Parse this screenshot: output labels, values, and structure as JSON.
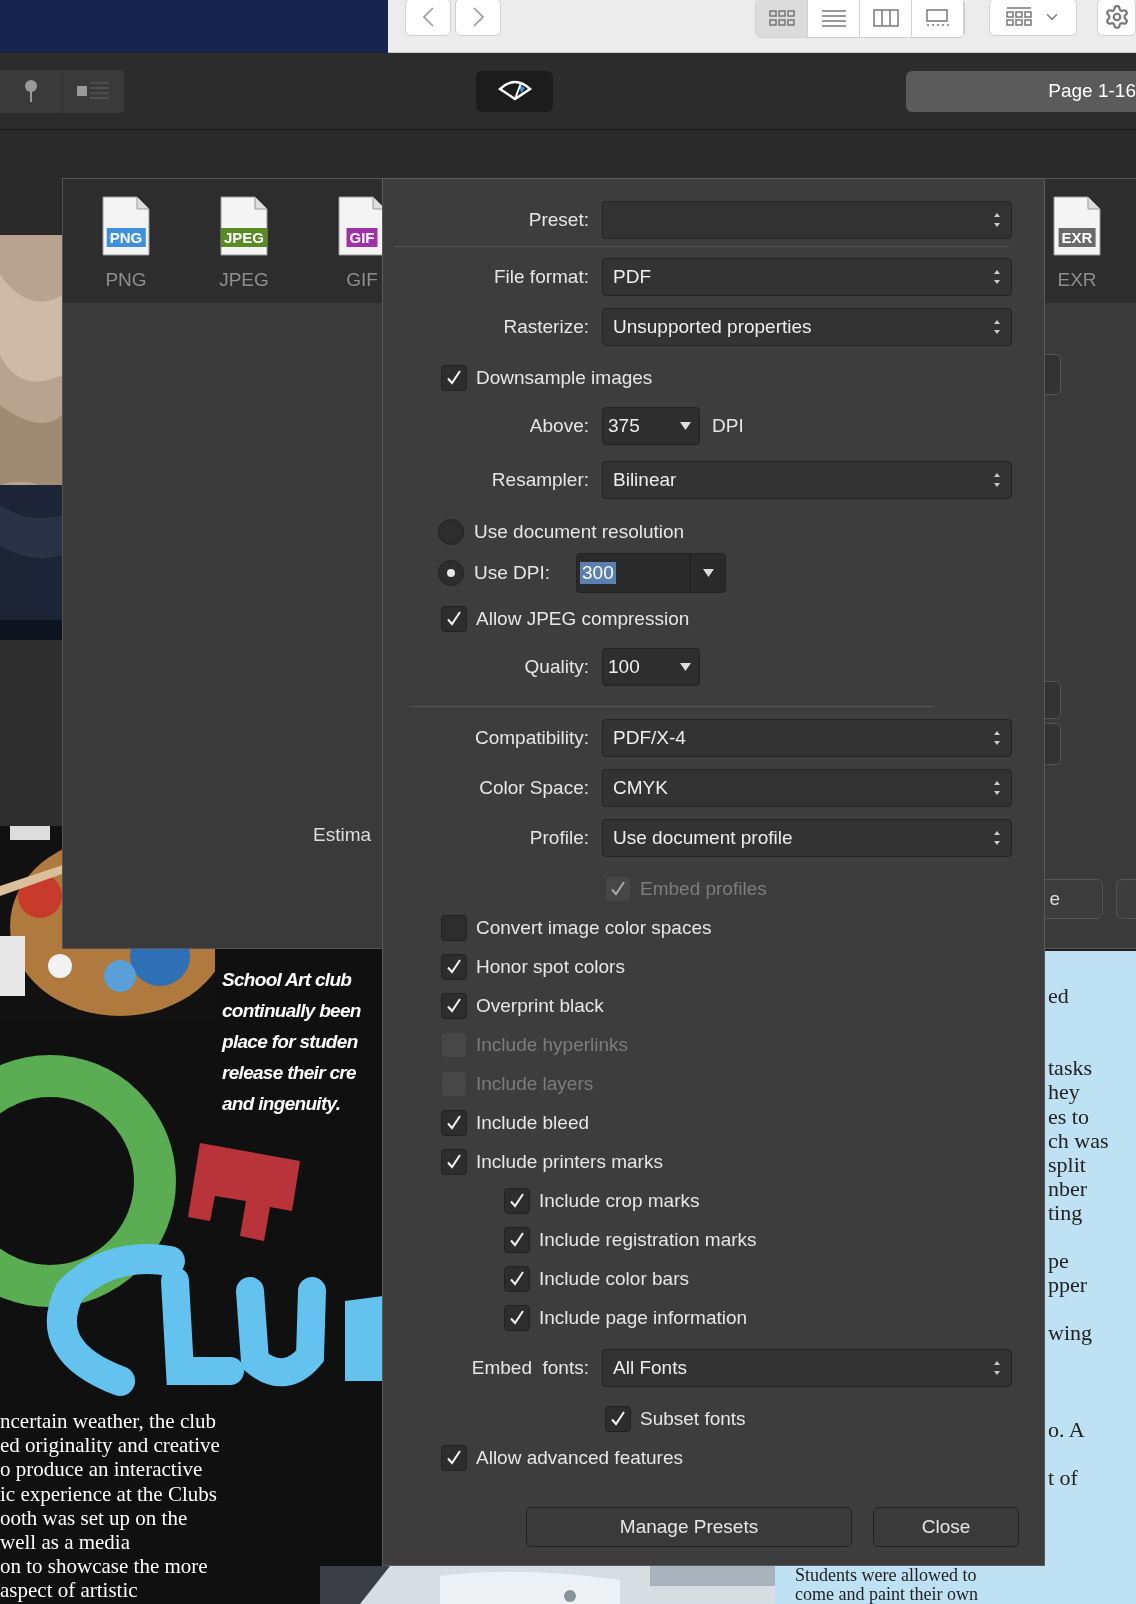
{
  "finder_toolbar": {
    "view_modes": [
      {
        "selected": true
      },
      {
        "selected": false
      },
      {
        "selected": false
      },
      {
        "selected": false
      }
    ]
  },
  "app_toolbar": {
    "page_field": "Page 1-16"
  },
  "export_window": {
    "formats": [
      {
        "badge": "PNG",
        "label": "PNG",
        "color": "#3d8fe0"
      },
      {
        "badge": "JPEG",
        "label": "JPEG",
        "color": "#5a8a24"
      },
      {
        "badge": "GIF",
        "label": "GIF",
        "color": "#a030a8"
      },
      {
        "badge": "EXR",
        "label": "EXR",
        "color": "#6a6a6a"
      }
    ],
    "estimate_label": "Estima",
    "action_button": "e"
  },
  "document": {
    "poster_lines": [
      "School Art club",
      "continually been",
      "place for studen",
      "release their cre",
      "and ingenuity."
    ],
    "poster_paragraph": [
      "ncertain weather, the club",
      "ed originality and creative",
      "o produce an interactive",
      "ic experience at the Clubs",
      "ooth was set up on the",
      "well as a media",
      "on to showcase the more",
      "aspect of artistic"
    ],
    "page_lines": [
      "ed",
      "tasks",
      "hey",
      "es to",
      "ch was",
      "split",
      "nber",
      "ting",
      "pe",
      "pper",
      "wing",
      "o. A",
      "t of"
    ],
    "page_bottom_lines": [
      "Students were allowed to",
      "come and paint their own"
    ]
  },
  "dialog": {
    "sections": [
      {
        "rows": [
          {
            "kind": "select",
            "label": "Preset:"
          }
        ]
      },
      {
        "rows": [
          {
            "kind": "select",
            "label": "File format:",
            "value": "PDF"
          },
          {
            "kind": "select",
            "label": "Rasterize:",
            "value": "Unsupported properties"
          },
          {
            "kind": "checkbox",
            "label": "Downsample images",
            "checked": true,
            "disabled": false
          },
          {
            "kind": "combo",
            "label": "Above:",
            "value": "375",
            "unit": "DPI"
          },
          {
            "kind": "select",
            "label": "Resampler:",
            "value": "Bilinear"
          },
          {
            "kind": "radio",
            "label": "Use document resolution",
            "selected": false
          },
          {
            "kind": "radio",
            "label": "Use DPI:",
            "selected": true,
            "value": "300"
          },
          {
            "kind": "checkbox",
            "label": "Allow JPEG compression",
            "checked": true,
            "disabled": false
          },
          {
            "kind": "combo",
            "label": "Quality:",
            "value": "100"
          }
        ]
      },
      {
        "rows": [
          {
            "kind": "select",
            "label": "Compatibility:",
            "value": "PDF/X-4"
          },
          {
            "kind": "select",
            "label": "Color Space:",
            "value": "CMYK"
          },
          {
            "kind": "select",
            "label": "Profile:",
            "value": "Use document profile"
          },
          {
            "kind": "subcheck",
            "label": "Embed profiles",
            "checked": true,
            "disabled": true
          },
          {
            "kind": "checkbox",
            "label": "Convert image color spaces",
            "checked": false,
            "disabled": false
          },
          {
            "kind": "checkbox",
            "label": "Honor spot colors",
            "checked": true,
            "disabled": false
          },
          {
            "kind": "checkbox",
            "label": "Overprint black",
            "checked": true,
            "disabled": false
          },
          {
            "kind": "checkbox",
            "label": "Include hyperlinks",
            "checked": false,
            "disabled": true
          },
          {
            "kind": "checkbox",
            "label": "Include layers",
            "checked": false,
            "disabled": true
          },
          {
            "kind": "checkbox",
            "label": "Include bleed",
            "checked": true,
            "disabled": false
          },
          {
            "kind": "checkbox",
            "label": "Include printers marks",
            "checked": true,
            "disabled": false,
            "children": [
              {
                "label": "Include crop marks",
                "checked": true,
                "disabled": false
              },
              {
                "label": "Include registration marks",
                "checked": true,
                "disabled": false
              },
              {
                "label": "Include color bars",
                "checked": true,
                "disabled": false
              },
              {
                "label": "Include page information",
                "checked": true,
                "disabled": false
              }
            ]
          },
          {
            "kind": "select",
            "label": "Embed  fonts:",
            "value": "All Fonts"
          },
          {
            "kind": "subcheck",
            "label": "Subset fonts",
            "checked": true,
            "disabled": false
          },
          {
            "kind": "checkbox",
            "label": "Allow advanced features",
            "checked": true,
            "disabled": false
          }
        ]
      }
    ],
    "buttons": [
      {
        "label": "Manage Presets"
      },
      {
        "label": "Close"
      }
    ]
  }
}
